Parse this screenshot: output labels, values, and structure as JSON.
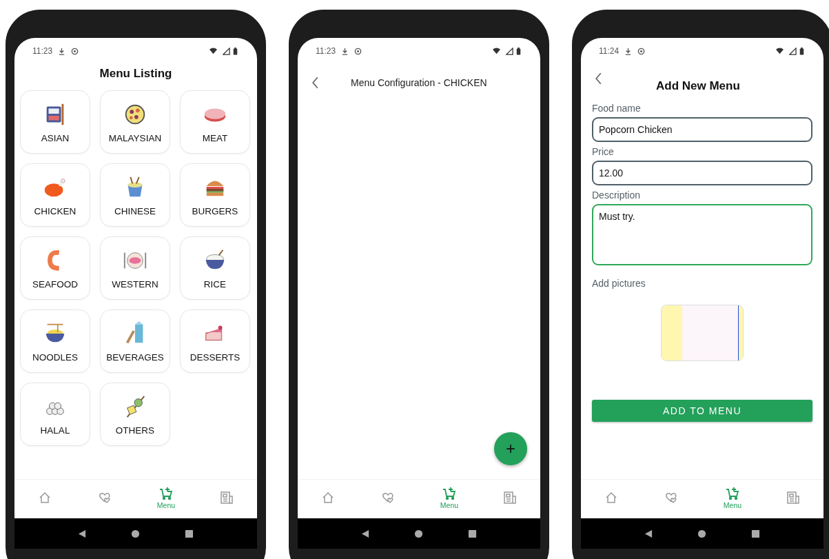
{
  "phones": [
    {
      "kind": "listing",
      "status": {
        "time": "11:23"
      },
      "title": "Menu Listing",
      "categories": [
        {
          "label": "ASIAN"
        },
        {
          "label": "MALAYSIAN"
        },
        {
          "label": "MEAT"
        },
        {
          "label": "CHICKEN"
        },
        {
          "label": "CHINESE"
        },
        {
          "label": "BURGERS"
        },
        {
          "label": "SEAFOOD"
        },
        {
          "label": "WESTERN"
        },
        {
          "label": "RICE"
        },
        {
          "label": "NOODLES"
        },
        {
          "label": "BEVERAGES"
        },
        {
          "label": "DESSERTS"
        },
        {
          "label": "HALAL"
        },
        {
          "label": "OTHERS"
        }
      ],
      "nav": [
        {
          "selected": false
        },
        {
          "selected": false
        },
        {
          "selected": true,
          "label": "Menu"
        },
        {
          "selected": false
        }
      ]
    },
    {
      "kind": "config",
      "status": {
        "time": "11:23"
      },
      "title": "Menu Configuration - CHICKEN",
      "fab": "+",
      "nav": [
        {
          "selected": false
        },
        {
          "selected": false
        },
        {
          "selected": true,
          "label": "Menu"
        },
        {
          "selected": false
        }
      ]
    },
    {
      "kind": "form",
      "status": {
        "time": "11:24"
      },
      "title": "Add New Menu",
      "fields": [
        {
          "label": "Food name",
          "value": "Popcorn Chicken",
          "focused": false,
          "multiline": false
        },
        {
          "label": "Price",
          "value": "12.00",
          "focused": false,
          "multiline": false
        },
        {
          "label": "Description",
          "value": "Must try.",
          "focused": true,
          "multiline": true
        }
      ],
      "pictures_label": "Add pictures",
      "submit": "ADD TO MENU",
      "nav": [
        {
          "selected": false
        },
        {
          "selected": false
        },
        {
          "selected": true,
          "label": "Menu"
        },
        {
          "selected": false
        }
      ]
    }
  ]
}
